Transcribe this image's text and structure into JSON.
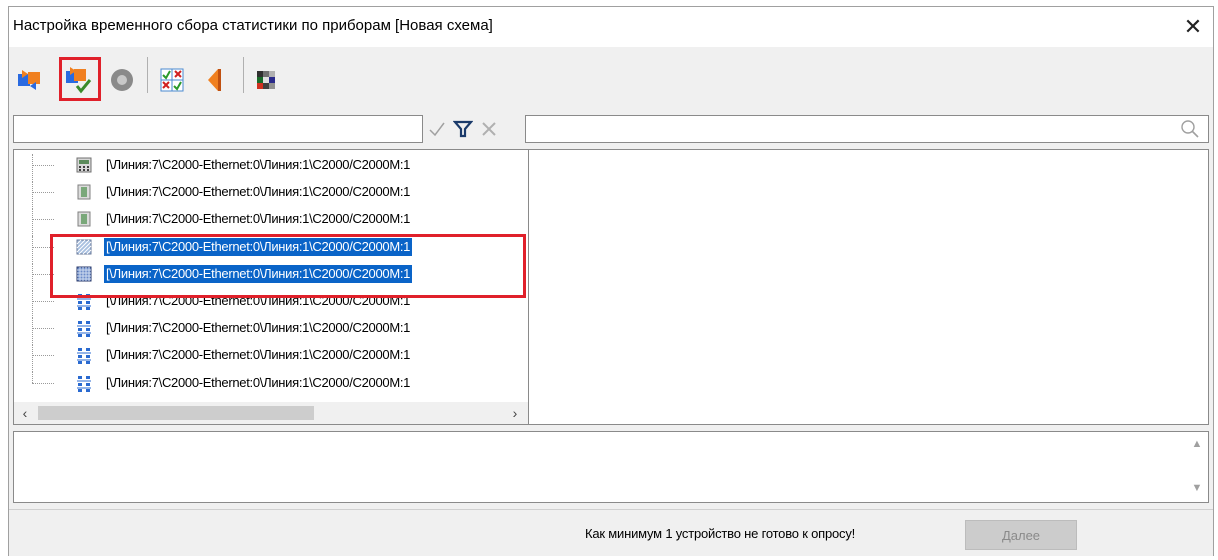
{
  "window": {
    "title": "Настройка временного сбора статистики по приборам [Новая схема]",
    "close_symbol": "✕"
  },
  "toolbar": {
    "buttons": [
      {
        "icon": "refresh-swap-icon"
      },
      {
        "icon": "refresh-check-icon",
        "highlighted": true
      },
      {
        "icon": "stop-circle-icon"
      },
      {
        "icon": "checklist-grid-icon"
      },
      {
        "icon": "arrow-left-orange-icon"
      },
      {
        "icon": "color-palette-icon"
      }
    ]
  },
  "filter": {
    "value": "",
    "apply_icon": "checkmark-icon",
    "filter_icon": "funnel-icon",
    "clear_icon": "clear-filter-icon"
  },
  "search": {
    "value": "",
    "icon": "magnifier-icon"
  },
  "tree": {
    "rows": [
      {
        "label": "[\\Линия:7\\C2000-Ethernet:0\\Линия:1\\C2000/C2000M:1",
        "icon": "keypad-device-icon",
        "selected": false
      },
      {
        "label": "[\\Линия:7\\C2000-Ethernet:0\\Линия:1\\C2000/C2000M:1",
        "icon": "panel-device-icon",
        "selected": false
      },
      {
        "label": "[\\Линия:7\\C2000-Ethernet:0\\Линия:1\\C2000/C2000M:1",
        "icon": "panel-device-icon",
        "selected": false
      },
      {
        "label": "[\\Линия:7\\C2000-Ethernet:0\\Линия:1\\C2000/C2000M:1",
        "icon": "hatched-device-icon",
        "selected": true
      },
      {
        "label": "[\\Линия:7\\C2000-Ethernet:0\\Линия:1\\C2000/C2000M:1",
        "icon": "grid-device-icon",
        "selected": true
      },
      {
        "label": "[\\Линия:7\\C2000-Ethernet:0\\Линия:1\\C2000/C2000M:1",
        "icon": "network-device-icon",
        "selected": false
      },
      {
        "label": "[\\Линия:7\\C2000-Ethernet:0\\Линия:1\\C2000/C2000M:1",
        "icon": "network-device-icon",
        "selected": false
      },
      {
        "label": "[\\Линия:7\\C2000-Ethernet:0\\Линия:1\\C2000/C2000M:1",
        "icon": "network-device-icon",
        "selected": false
      },
      {
        "label": "[\\Линия:7\\C2000-Ethernet:0\\Линия:1\\C2000/C2000M:1",
        "icon": "network-device-icon",
        "selected": false
      }
    ],
    "scroll_left": "‹",
    "scroll_right": "›"
  },
  "log": {
    "text": ""
  },
  "status": {
    "message": "Как минимум 1 устройство не готово к опросу!",
    "next_label": "Далее"
  },
  "colors": {
    "selection": "#0a64c8",
    "highlight_box": "#e0202a",
    "window_bg": "#f0f0f0"
  }
}
